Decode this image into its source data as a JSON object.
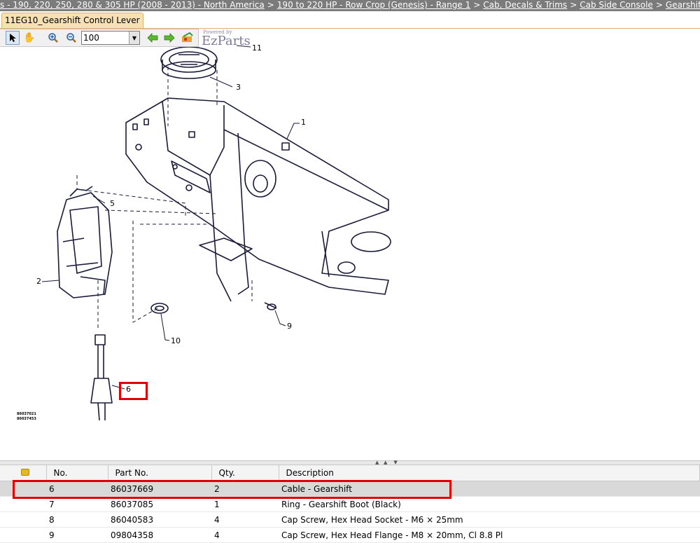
{
  "breadcrumb": [
    "s - 190, 220, 250, 280 & 305 HP (2008 - 2013) - North America",
    "190 to 220 HP - Row Crop (Genesis) - Range 1",
    "Cab, Decals & Trims",
    "Cab Side Console",
    "Gearshift Control Lever"
  ],
  "breadcrumb_sep": ">",
  "tab": {
    "label": "11EG10_Gearshift Control Lever"
  },
  "toolbar": {
    "zoom_value": "100",
    "powered_by": "Powered by",
    "brand": "EzParts"
  },
  "diagram": {
    "callouts": [
      "11",
      "3",
      "1",
      "5",
      "2",
      "10",
      "9",
      "6"
    ],
    "ref_codes": [
      "86037021",
      "86037453"
    ]
  },
  "table": {
    "columns": [
      "",
      "No.",
      "Part No.",
      "Qty.",
      "Description"
    ],
    "rows": [
      {
        "no": "6",
        "part": "86037669",
        "qty": "2",
        "desc": "Cable - Gearshift",
        "selected": true
      },
      {
        "no": "7",
        "part": "86037085",
        "qty": "1",
        "desc": "Ring - Gearshift Boot (Black)"
      },
      {
        "no": "8",
        "part": "86040583",
        "qty": "4",
        "desc": "Cap Screw, Hex Head Socket - M6 × 25mm"
      },
      {
        "no": "9",
        "part": "09804358",
        "qty": "4",
        "desc": "Cap Screw, Hex Head Flange - M8 × 20mm, Cl 8.8 Pl"
      }
    ]
  },
  "colors": {
    "highlight": "#e00000",
    "breadcrumb_bg": "#7b7b7b",
    "tab_bg": "#f6e1b5"
  }
}
